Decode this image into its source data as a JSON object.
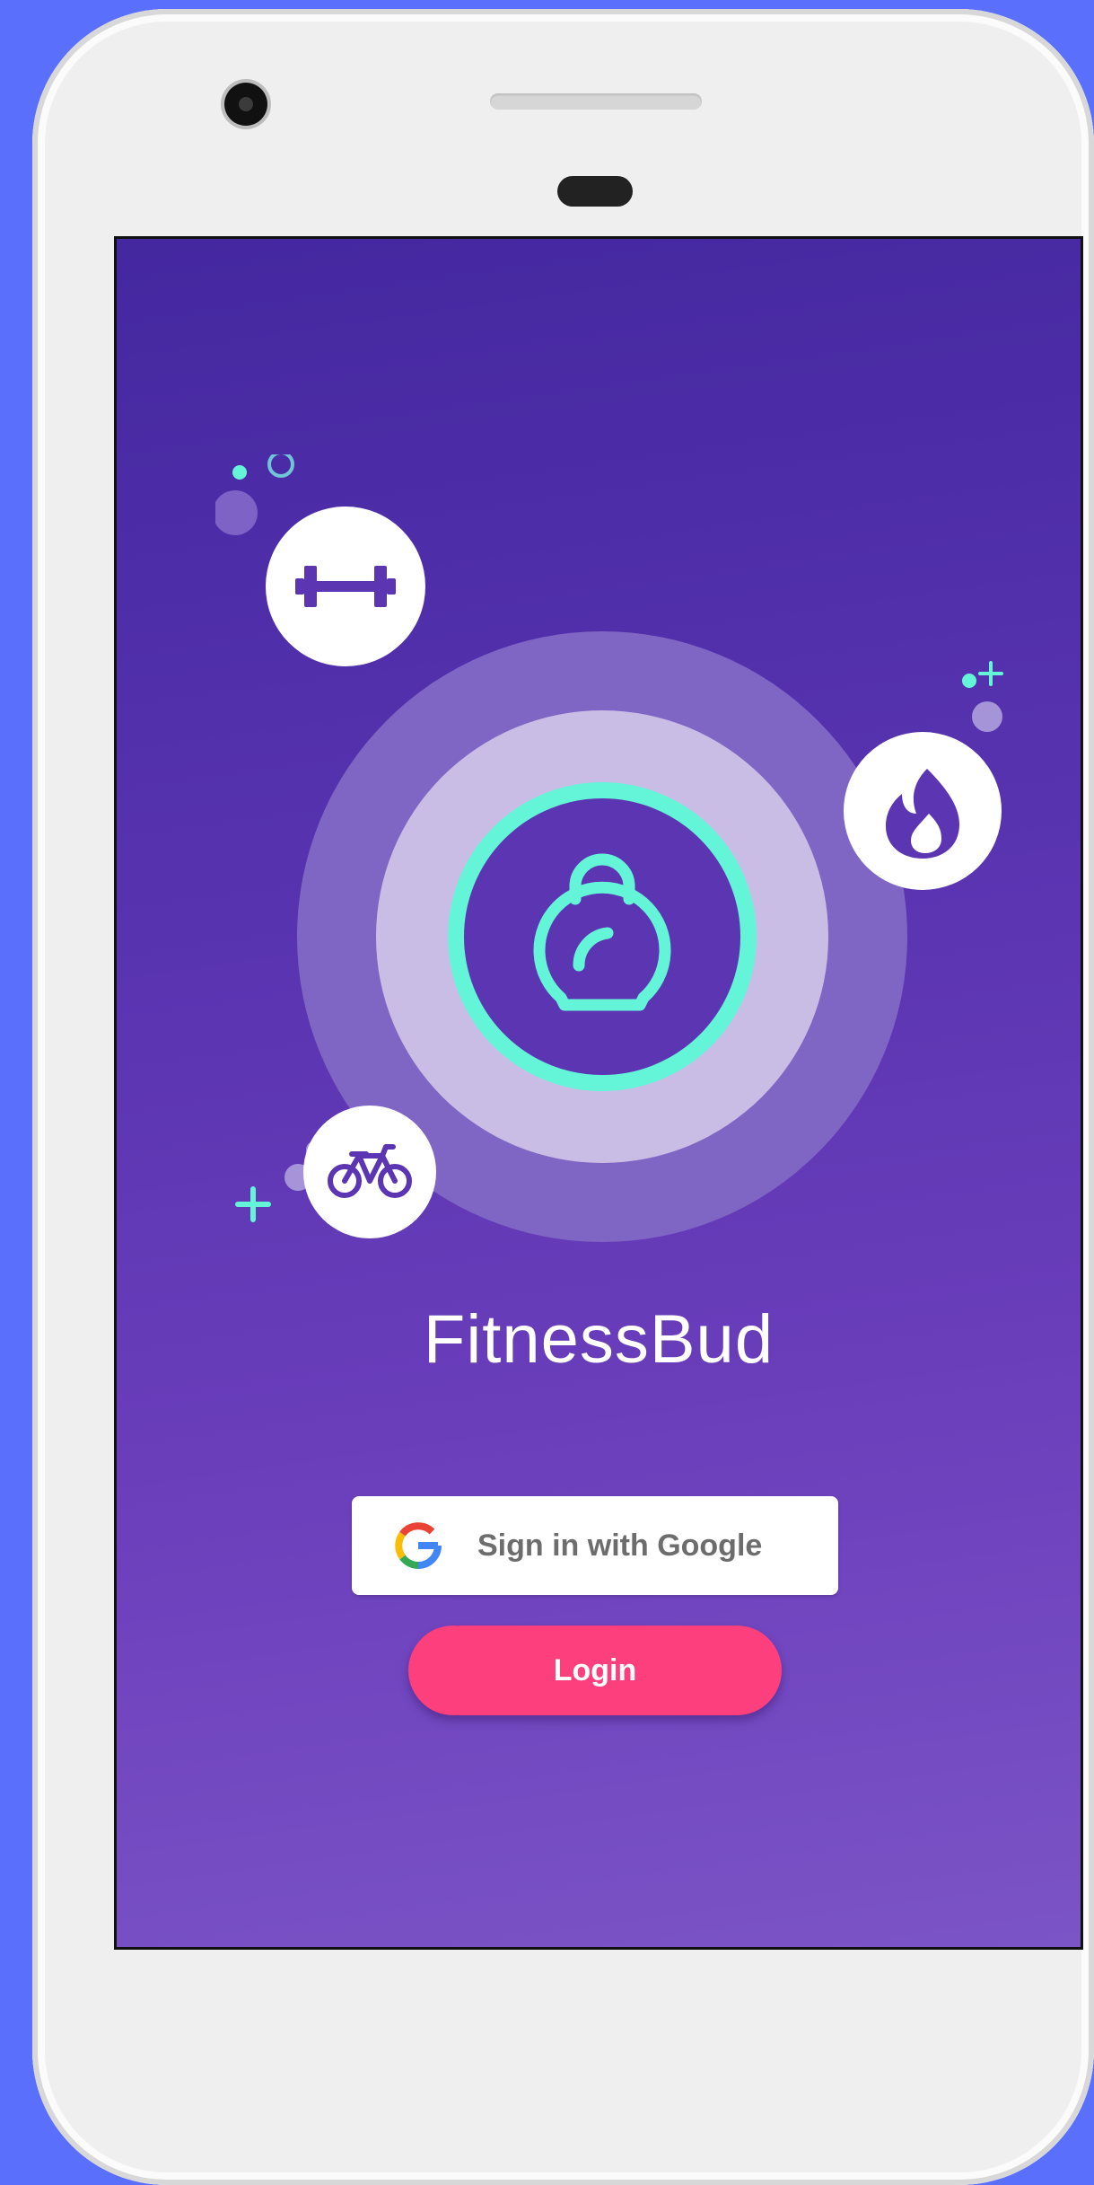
{
  "app": {
    "title": "FitnessBud"
  },
  "auth": {
    "google_label": "Sign in with Google",
    "login_label": "Login"
  },
  "icons": {
    "center": "kettlebell-icon",
    "top_left": "dumbbell-icon",
    "right": "flame-icon",
    "bottom_left": "bicycle-icon",
    "google": "google-logo-icon"
  },
  "colors": {
    "accent": "#64f5d9",
    "primary": "#5c35b2",
    "login_button": "#fd3f7e",
    "background_gradient_start": "#4428a0",
    "background_gradient_end": "#7b54c6"
  }
}
